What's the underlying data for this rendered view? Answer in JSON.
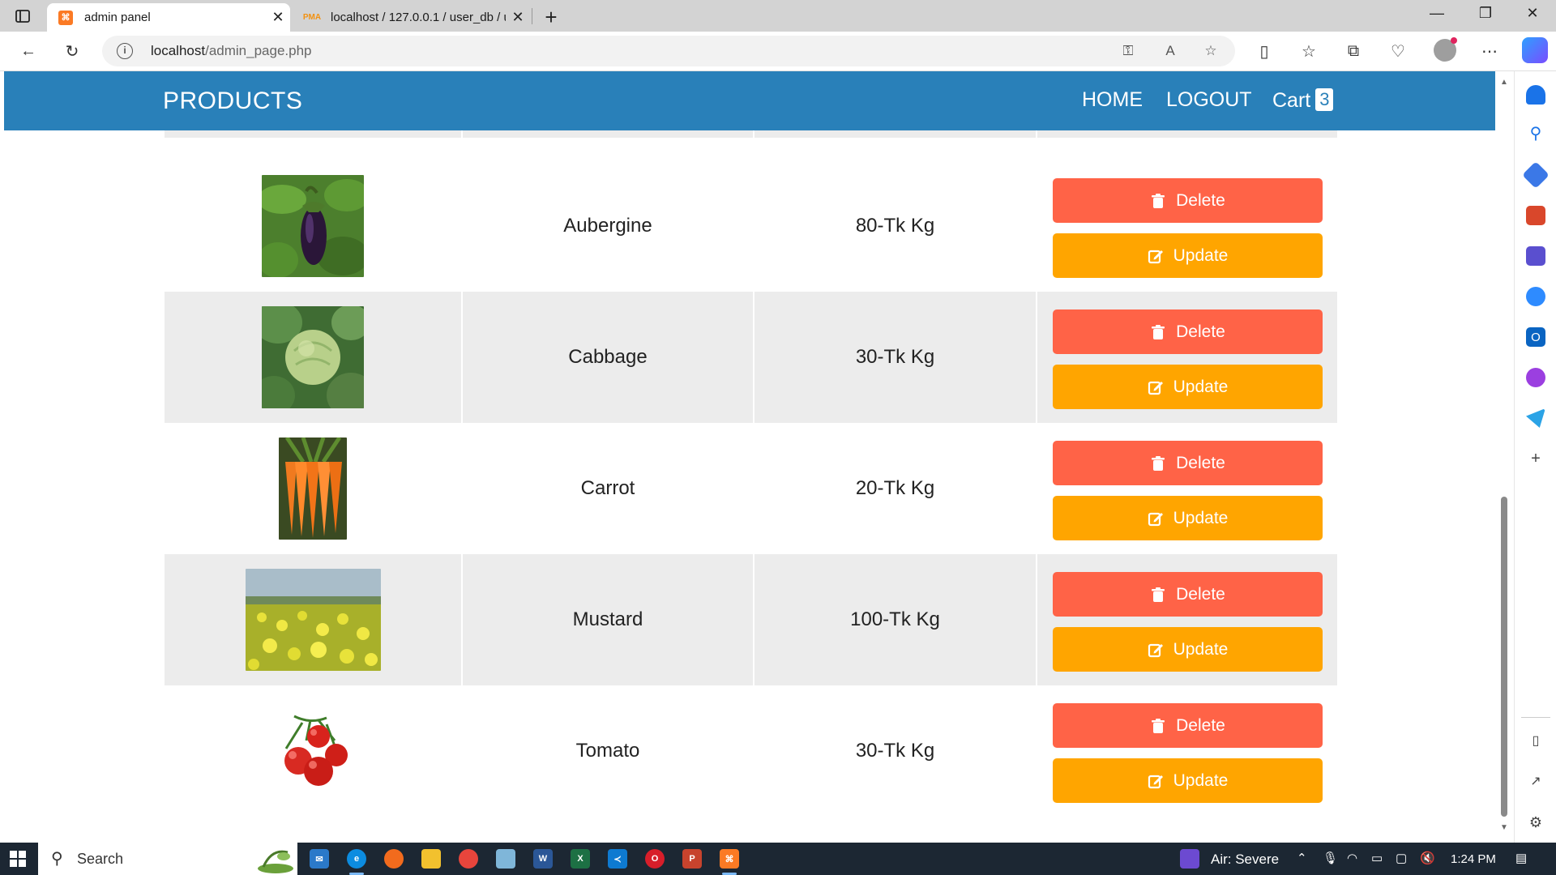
{
  "browser": {
    "tabs": [
      {
        "title": "admin panel",
        "active": true
      },
      {
        "title": "localhost / 127.0.0.1 / user_db / u",
        "active": false
      }
    ],
    "url_host": "localhost",
    "url_path": "/admin_page.php"
  },
  "header": {
    "logo": "PRODUCTS",
    "nav": {
      "home": "HOME",
      "logout": "LOGOUT",
      "cart": "Cart",
      "cart_count": "3"
    }
  },
  "products": [
    {
      "name": "Aubergine",
      "price": "80-Tk Kg",
      "image": "aubergine",
      "delete_label": "Delete",
      "update_label": "Update"
    },
    {
      "name": "Cabbage",
      "price": "30-Tk Kg",
      "image": "cabbage",
      "delete_label": "Delete",
      "update_label": "Update"
    },
    {
      "name": "Carrot",
      "price": "20-Tk Kg",
      "image": "carrot",
      "delete_label": "Delete",
      "update_label": "Update"
    },
    {
      "name": "Mustard",
      "price": "100-Tk Kg",
      "image": "mustard",
      "delete_label": "Delete",
      "update_label": "Update"
    },
    {
      "name": "Tomato",
      "price": "30-Tk Kg",
      "image": "tomato",
      "delete_label": "Delete",
      "update_label": "Update"
    }
  ],
  "taskbar": {
    "search_label": "Search",
    "weather": "Air: Severe",
    "time": "1:24 PM"
  },
  "colors": {
    "header": "#2980b9",
    "delete": "#ff6347",
    "update": "#ffa500",
    "row_alt": "#ececec"
  }
}
